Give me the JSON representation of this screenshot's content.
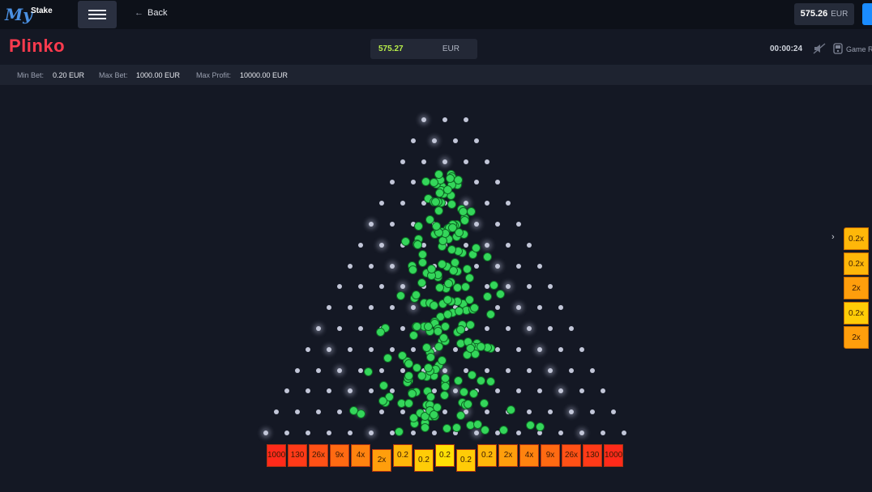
{
  "brand": {
    "logo_text": "My",
    "logo_sub": "Stake"
  },
  "nav": {
    "back_label": "Back"
  },
  "header_balance": {
    "amount": "575.26",
    "currency": "EUR"
  },
  "game": {
    "title": "Plinko",
    "balance": {
      "amount": "575.27",
      "currency": "EUR"
    },
    "timer": "00:00:24",
    "rules_label": "Game R"
  },
  "limits": {
    "min_bet_label": "Min Bet:",
    "min_bet": "0.20 EUR",
    "max_bet_label": "Max Bet:",
    "max_bet": "1000.00 EUR",
    "max_profit_label": "Max Profit:",
    "max_profit": "10000.00 EUR"
  },
  "board": {
    "rows": 16,
    "buckets": [
      {
        "label": "1000",
        "color": "#ff2a1a"
      },
      {
        "label": "130",
        "color": "#ff3a18"
      },
      {
        "label": "26x",
        "color": "#ff5116"
      },
      {
        "label": "9x",
        "color": "#ff6a12"
      },
      {
        "label": "4x",
        "color": "#ff830f"
      },
      {
        "label": "2x",
        "color": "#ff9e0c"
      },
      {
        "label": "0.2",
        "color": "#ffb709"
      },
      {
        "label": "0.2",
        "color": "#ffcc07"
      },
      {
        "label": "0.2",
        "color": "#ffe005"
      },
      {
        "label": "0.2",
        "color": "#ffcc07"
      },
      {
        "label": "0.2",
        "color": "#ffb709"
      },
      {
        "label": "2x",
        "color": "#ff9e0c"
      },
      {
        "label": "4x",
        "color": "#ff830f"
      },
      {
        "label": "9x",
        "color": "#ff6a12"
      },
      {
        "label": "26x",
        "color": "#ff5116"
      },
      {
        "label": "130",
        "color": "#ff3a18"
      },
      {
        "label": "1000",
        "color": "#ff2a1a"
      }
    ],
    "active_buckets": [
      5,
      7,
      9
    ],
    "balls_in_play": 210
  },
  "history": [
    {
      "label": "0.2x",
      "color": "#ffb709"
    },
    {
      "label": "0.2x",
      "color": "#ffb709"
    },
    {
      "label": "2x",
      "color": "#ff9e0c"
    },
    {
      "label": "0.2x",
      "color": "#ffcc07"
    },
    {
      "label": "2x",
      "color": "#ff9e0c"
    }
  ]
}
